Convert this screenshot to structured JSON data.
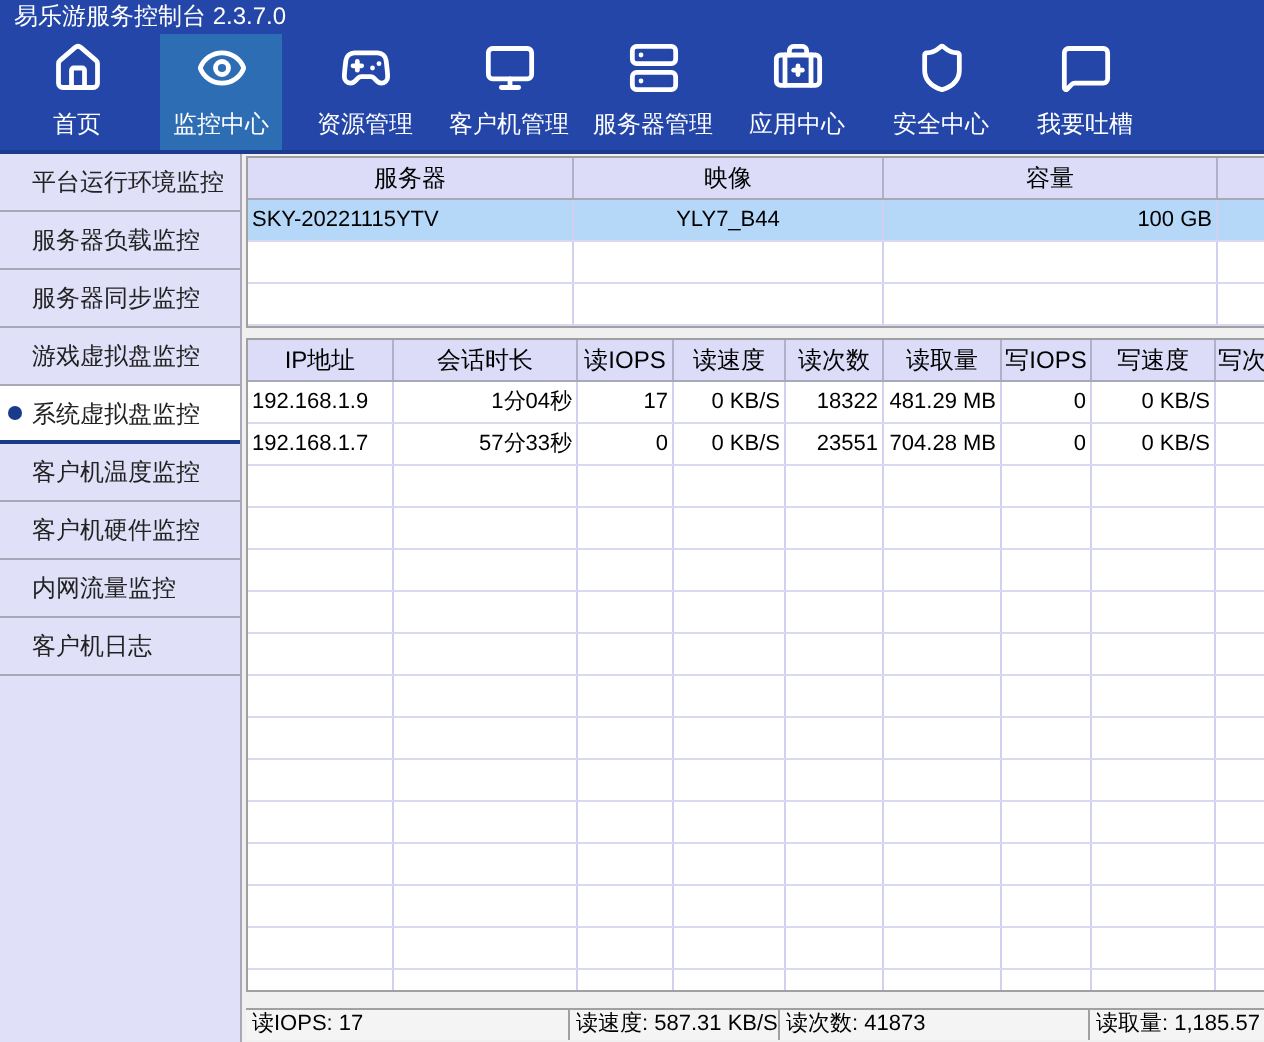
{
  "window": {
    "title": "易乐游服务控制台 2.3.7.0"
  },
  "nav": [
    {
      "label": "首页",
      "kind": "home",
      "selected": false
    },
    {
      "label": "监控中心",
      "kind": "eye",
      "selected": true
    },
    {
      "label": "资源管理",
      "kind": "gamepad",
      "selected": false
    },
    {
      "label": "客户机管理",
      "kind": "monitor",
      "selected": false
    },
    {
      "label": "服务器管理",
      "kind": "server",
      "selected": false
    },
    {
      "label": "应用中心",
      "kind": "toolbox",
      "selected": false
    },
    {
      "label": "安全中心",
      "kind": "shield",
      "selected": false
    },
    {
      "label": "我要吐槽",
      "kind": "message",
      "selected": false
    }
  ],
  "sidebar": {
    "items": [
      {
        "label": "平台运行环境监控",
        "selected": false
      },
      {
        "label": "服务器负载监控",
        "selected": false
      },
      {
        "label": "服务器同步监控",
        "selected": false
      },
      {
        "label": "游戏虚拟盘监控",
        "selected": false
      },
      {
        "label": "系统虚拟盘监控",
        "selected": true
      },
      {
        "label": "客户机温度监控",
        "selected": false
      },
      {
        "label": "客户机硬件监控",
        "selected": false
      },
      {
        "label": "内网流量监控",
        "selected": false
      },
      {
        "label": "客户机日志",
        "selected": false
      }
    ]
  },
  "server_table": {
    "columns": [
      "服务器",
      "映像",
      "容量"
    ],
    "rows": [
      {
        "cells": [
          "SKY-20221115YTV",
          "YLY7_B44",
          "100 GB"
        ],
        "selected": true
      }
    ]
  },
  "session_table": {
    "columns": [
      "IP地址",
      "会话时长",
      "读IOPS",
      "读速度",
      "读次数",
      "读取量",
      "写IOPS",
      "写速度",
      "写次"
    ],
    "rows": [
      {
        "cells": [
          "192.168.1.9",
          "1分04秒",
          "17",
          "0 KB/S",
          "18322",
          "481.29 MB",
          "0",
          "0 KB/S"
        ]
      },
      {
        "cells": [
          "192.168.1.7",
          "57分33秒",
          "0",
          "0 KB/S",
          "23551",
          "704.28 MB",
          "0",
          "0 KB/S"
        ]
      }
    ]
  },
  "status_bar": [
    "读IOPS: 17",
    "读速度: 587.31 KB/S",
    "读次数: 41873",
    "读取量: 1,185.57"
  ]
}
